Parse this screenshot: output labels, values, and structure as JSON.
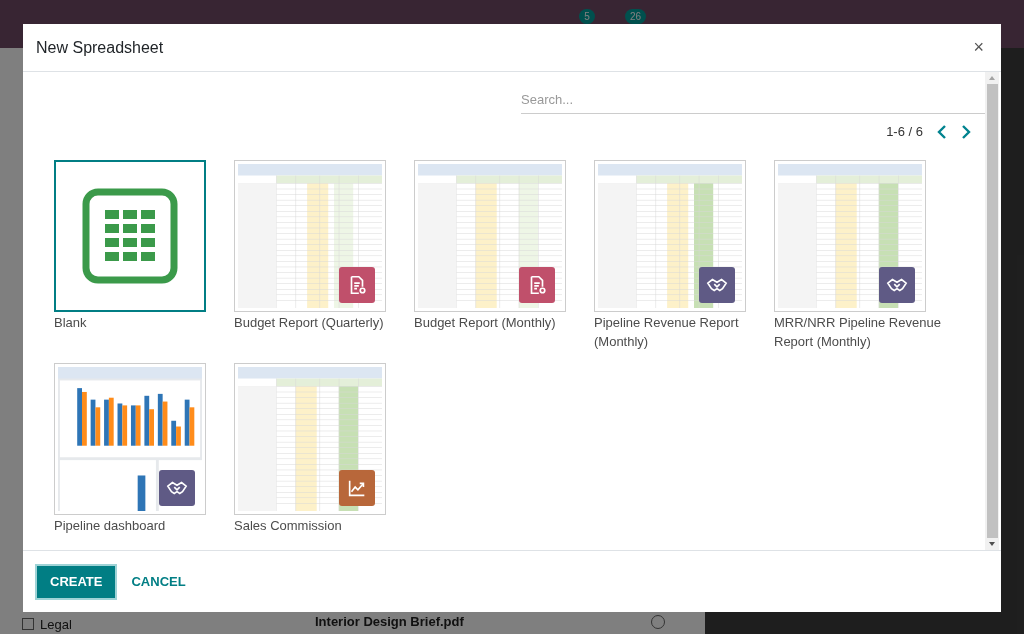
{
  "navbar": {
    "badges": [
      "5",
      "26"
    ]
  },
  "background": {
    "filters": [
      {
        "label": "Legal",
        "checked": false
      }
    ],
    "file": {
      "name": "Interior Design Brief.pdf",
      "selected": false
    }
  },
  "dialog": {
    "title": "New Spreadsheet",
    "close": "×",
    "search": {
      "placeholder": "Search..."
    },
    "pager": "1-6 / 6",
    "templates": [
      {
        "name": "Blank",
        "kind": "blank",
        "selected": true
      },
      {
        "name": "Budget Report (Quarterly)",
        "kind": "sheet",
        "badge": {
          "kind": "report"
        },
        "selected": false
      },
      {
        "name": "Budget Report (Monthly)",
        "kind": "sheet",
        "badge": {
          "kind": "report"
        },
        "selected": false
      },
      {
        "name": "Pipeline Revenue Report (Monthly)",
        "kind": "sheet",
        "badge": {
          "kind": "handshake"
        },
        "selected": false
      },
      {
        "name": "MRR/NRR Pipeline Revenue Report (Monthly)",
        "kind": "sheet",
        "badge": {
          "kind": "handshake"
        },
        "selected": false
      },
      {
        "name": "Pipeline dashboard",
        "kind": "dashboard",
        "badge": {
          "kind": "handshake"
        },
        "selected": false
      },
      {
        "name": "Sales Commission",
        "kind": "sheet",
        "badge": {
          "kind": "chart"
        },
        "selected": false
      }
    ],
    "buttons": [
      {
        "label": "CREATE",
        "kind": "primary"
      },
      {
        "label": "CANCEL",
        "kind": "link"
      }
    ]
  }
}
